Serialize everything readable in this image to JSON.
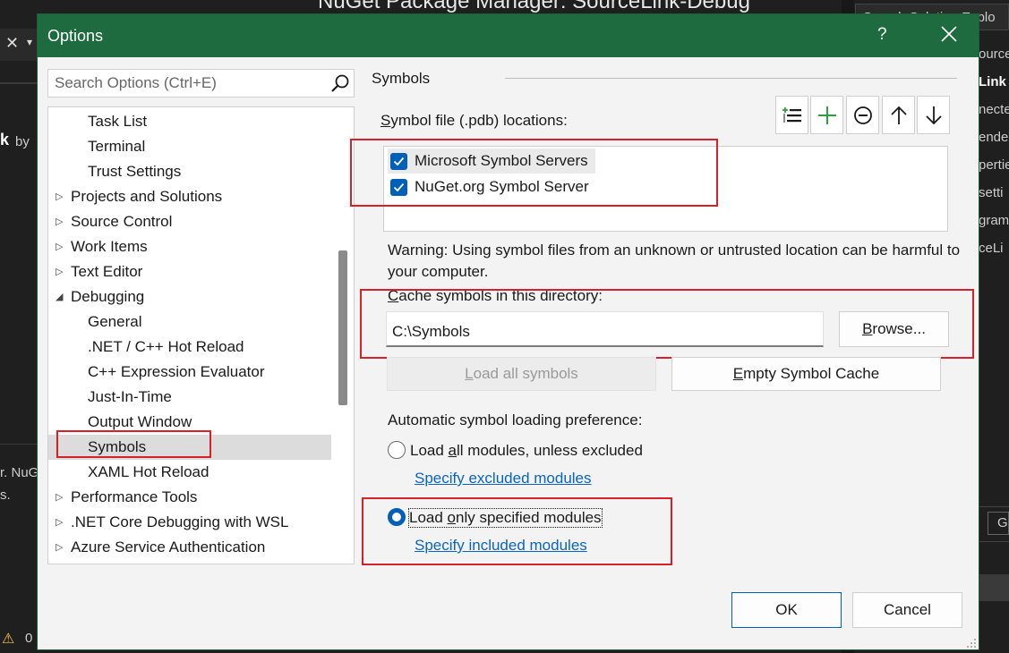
{
  "background": {
    "window_title": "NuGet Package Manager: SourceLink-Debug",
    "left_fragments": [
      "k",
      "by",
      "r. NuG",
      "s.",
      "0"
    ],
    "right_panel_title": "Search Solution Explo",
    "right_items": [
      "ource",
      "Link",
      "necte",
      "ende",
      "pertie",
      "setti",
      "gram",
      "ceLi"
    ],
    "right_button": "G"
  },
  "dialog": {
    "title": "Options",
    "help": "?"
  },
  "search": {
    "placeholder": "Search Options (Ctrl+E)"
  },
  "tree": {
    "items": [
      {
        "label": "Task List",
        "level": 2,
        "arrow": ""
      },
      {
        "label": "Terminal",
        "level": 2,
        "arrow": ""
      },
      {
        "label": "Trust Settings",
        "level": 2,
        "arrow": ""
      },
      {
        "label": "Projects and Solutions",
        "level": 1,
        "arrow": "collapsed"
      },
      {
        "label": "Source Control",
        "level": 1,
        "arrow": "collapsed"
      },
      {
        "label": "Work Items",
        "level": 1,
        "arrow": "collapsed"
      },
      {
        "label": "Text Editor",
        "level": 1,
        "arrow": "collapsed"
      },
      {
        "label": "Debugging",
        "level": 1,
        "arrow": "expanded"
      },
      {
        "label": "General",
        "level": 2,
        "arrow": ""
      },
      {
        "label": ".NET / C++ Hot Reload",
        "level": 2,
        "arrow": ""
      },
      {
        "label": "C++ Expression Evaluator",
        "level": 2,
        "arrow": ""
      },
      {
        "label": "Just-In-Time",
        "level": 2,
        "arrow": ""
      },
      {
        "label": "Output Window",
        "level": 2,
        "arrow": ""
      },
      {
        "label": "Symbols",
        "level": 2,
        "arrow": "",
        "selected": true
      },
      {
        "label": "XAML Hot Reload",
        "level": 2,
        "arrow": ""
      },
      {
        "label": "Performance Tools",
        "level": 1,
        "arrow": "collapsed"
      },
      {
        "label": ".NET Core Debugging with WSL",
        "level": 1,
        "arrow": "collapsed"
      },
      {
        "label": "Azure Service Authentication",
        "level": 1,
        "arrow": "collapsed"
      }
    ]
  },
  "panel": {
    "heading": "Symbols",
    "locations_label": "Symbol file (.pdb) locations:",
    "locations": [
      {
        "label": "Microsoft Symbol Servers",
        "checked": true
      },
      {
        "label": "NuGet.org Symbol Server",
        "checked": true
      }
    ],
    "warning": "Warning: Using symbol files from an unknown or untrusted location can be harmful to your computer.",
    "cache_label_rest": "ache symbols in this directory:",
    "cache_label_key": "C",
    "cache_path": "C:\\Symbols",
    "browse_key": "B",
    "browse_rest": "rowse...",
    "load_all_key": "L",
    "load_all_rest": "oad all symbols",
    "empty_cache_key": "E",
    "empty_cache_rest": "mpty Symbol Cache",
    "auto_label": "Automatic symbol loading preference:",
    "option1_pre": "Load ",
    "option1_key": "a",
    "option1_rest": "ll modules, unless excluded",
    "option1_link": "Specify excluded modules",
    "option2_pre": "Load ",
    "option2_key": "o",
    "option2_rest": "nly specified modules",
    "option2_link": "Specify included modules",
    "selected_option": "only_specified"
  },
  "footer": {
    "ok": "OK",
    "cancel": "Cancel"
  },
  "colors": {
    "titlebar": "#1e6b40",
    "accent": "#005fb8",
    "highlight_box": "#d8202a",
    "link": "#0a65c2"
  }
}
